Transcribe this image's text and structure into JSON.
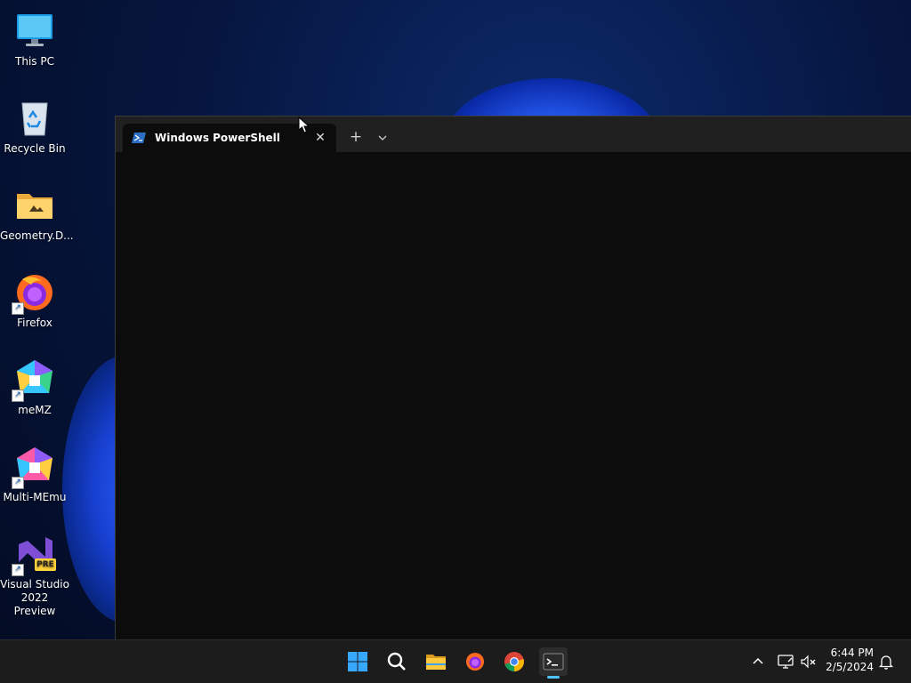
{
  "desktop": {
    "icons": [
      {
        "label": "This PC",
        "icon": "monitor-icon"
      },
      {
        "label": "Recycle Bin",
        "icon": "recycle-bin-icon"
      },
      {
        "label": "Geometry.D...",
        "icon": "folder-icon"
      },
      {
        "label": "Firefox",
        "icon": "firefox-icon"
      },
      {
        "label": "meMZ",
        "icon": "memz-icon"
      },
      {
        "label": "Multi-MEmu",
        "icon": "multi-memu-icon"
      },
      {
        "label_line1": "Visual Studio",
        "label_line2": "2022 Preview",
        "icon": "visual-studio-icon",
        "badge": "PRE"
      }
    ]
  },
  "terminal": {
    "tab_title": "Windows PowerShell",
    "close_glyph": "✕",
    "new_tab_glyph": "+",
    "colors": {
      "background": "#0c0c0c",
      "titlebar": "#202020"
    }
  },
  "taskbar": {
    "apps": [
      "start-icon",
      "search-icon",
      "file-explorer-icon",
      "firefox-icon",
      "chrome-icon",
      "terminal-icon"
    ],
    "active_app": "terminal-icon",
    "clock": {
      "time": "6:44 PM",
      "date": "2/5/2024"
    },
    "accent": "#4cc2ff"
  }
}
